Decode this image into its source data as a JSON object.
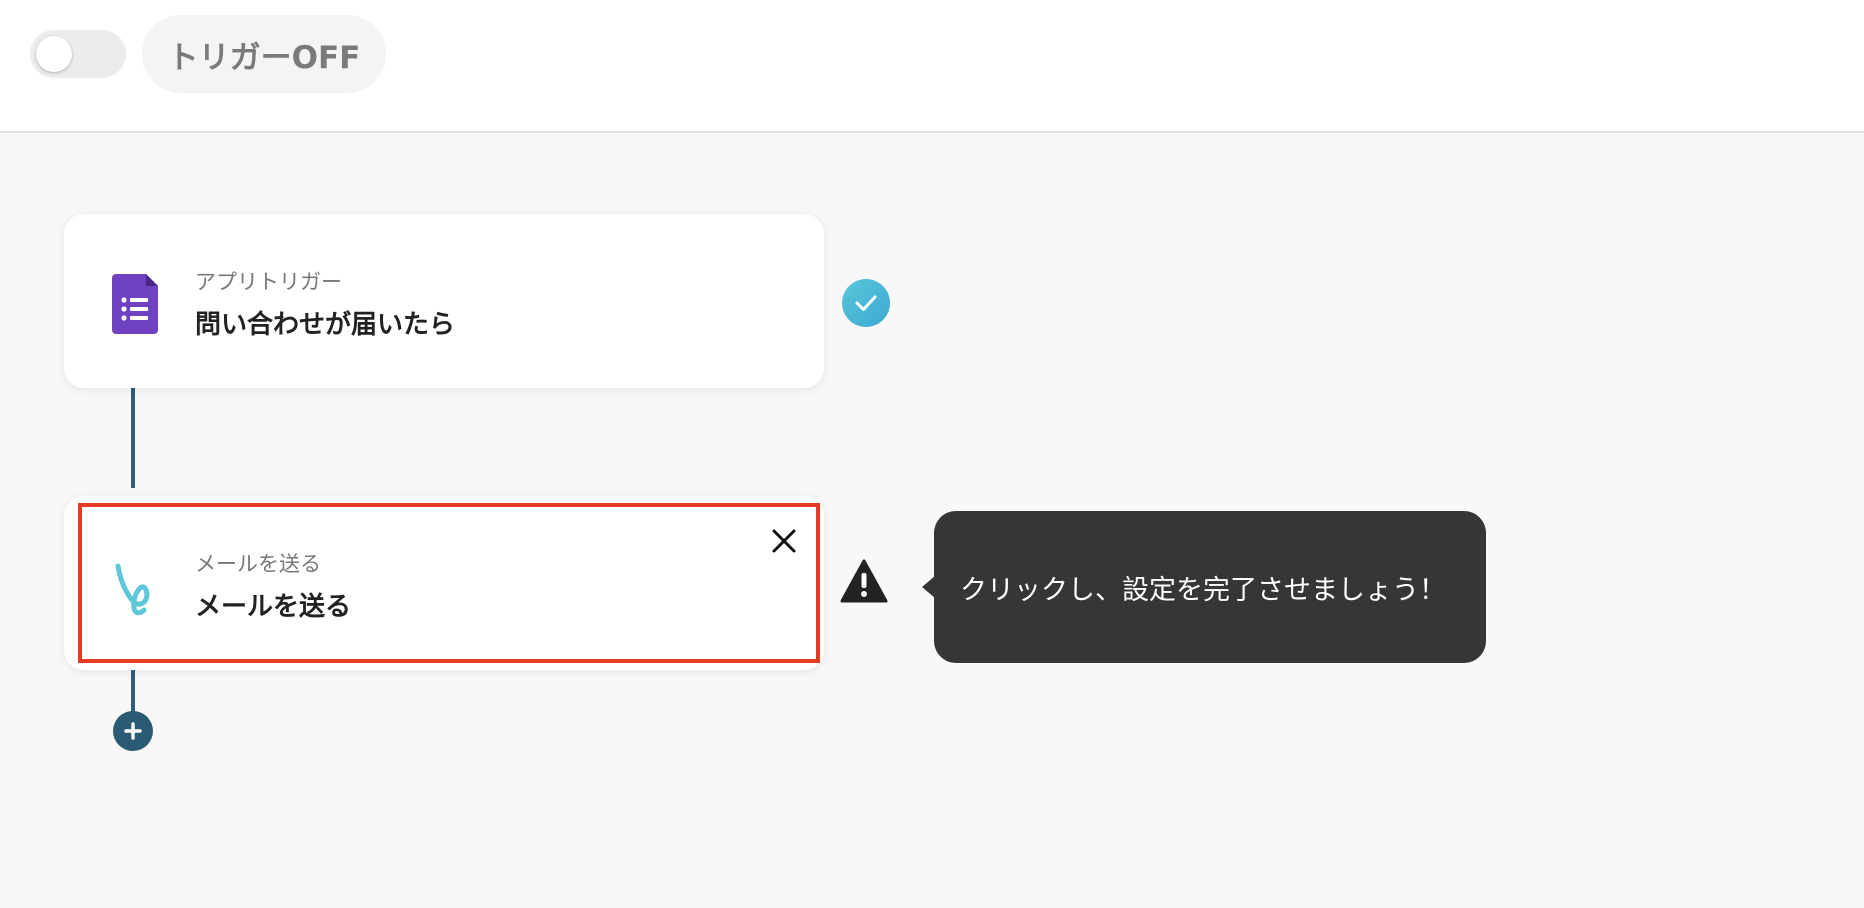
{
  "header": {
    "toggle_state": "off",
    "trigger_label": "トリガーOFF"
  },
  "flow": {
    "steps": [
      {
        "subtitle": "アプリトリガー",
        "title": "問い合わせが届いたら",
        "icon": "google-forms-icon",
        "status": "complete"
      },
      {
        "subtitle": "メールを送る",
        "title": "メールを送る",
        "icon": "mail-app-icon",
        "status": "incomplete"
      }
    ]
  },
  "tooltip": {
    "text": "クリックし、設定を完了させましょう！"
  },
  "colors": {
    "connector": "#2f5f78",
    "highlight_border": "#e53b22",
    "check_badge": "#4bb8d6",
    "forms_purple": "#6f42c1",
    "mail_icon": "#5cc8d8",
    "tooltip_bg": "#363636"
  }
}
